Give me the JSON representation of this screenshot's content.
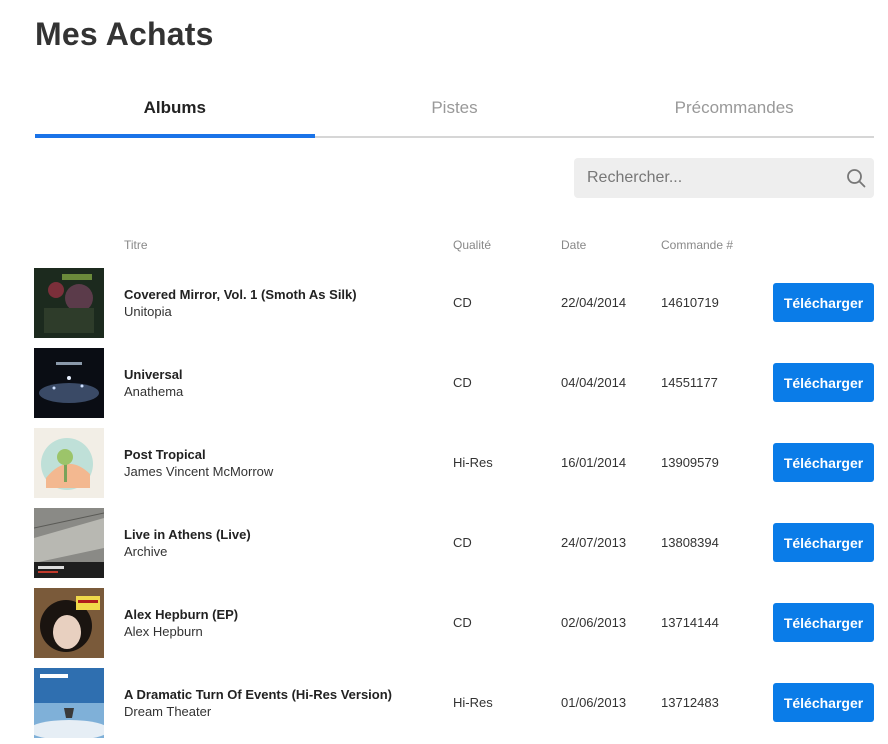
{
  "page": {
    "title": "Mes Achats"
  },
  "tabs": [
    {
      "label": "Albums",
      "active": true
    },
    {
      "label": "Pistes",
      "active": false
    },
    {
      "label": "Précommandes",
      "active": false
    }
  ],
  "search": {
    "placeholder": "Rechercher...",
    "icon": "search-icon"
  },
  "columns": {
    "title": "Titre",
    "quality": "Qualité",
    "date": "Date",
    "order": "Commande #"
  },
  "accent_color": "#0a7ce8",
  "rows": [
    {
      "title": "Covered Mirror, Vol. 1 (Smoth As Silk)",
      "artist": "Unitopia",
      "quality": "CD",
      "date": "22/04/2014",
      "order": "14610719",
      "button": "Télécharger"
    },
    {
      "title": "Universal",
      "artist": "Anathema",
      "quality": "CD",
      "date": "04/04/2014",
      "order": "14551177",
      "button": "Télécharger"
    },
    {
      "title": "Post Tropical",
      "artist": "James Vincent McMorrow",
      "quality": "Hi-Res",
      "date": "16/01/2014",
      "order": "13909579",
      "button": "Télécharger"
    },
    {
      "title": "Live in Athens (Live)",
      "artist": "Archive",
      "quality": "CD",
      "date": "24/07/2013",
      "order": "13808394",
      "button": "Télécharger"
    },
    {
      "title": "Alex Hepburn (EP)",
      "artist": "Alex Hepburn",
      "quality": "CD",
      "date": "02/06/2013",
      "order": "13714144",
      "button": "Télécharger"
    },
    {
      "title": "A Dramatic Turn Of Events (Hi-Res Version)",
      "artist": "Dream Theater",
      "quality": "Hi-Res",
      "date": "01/06/2013",
      "order": "13712483",
      "button": "Télécharger"
    }
  ]
}
